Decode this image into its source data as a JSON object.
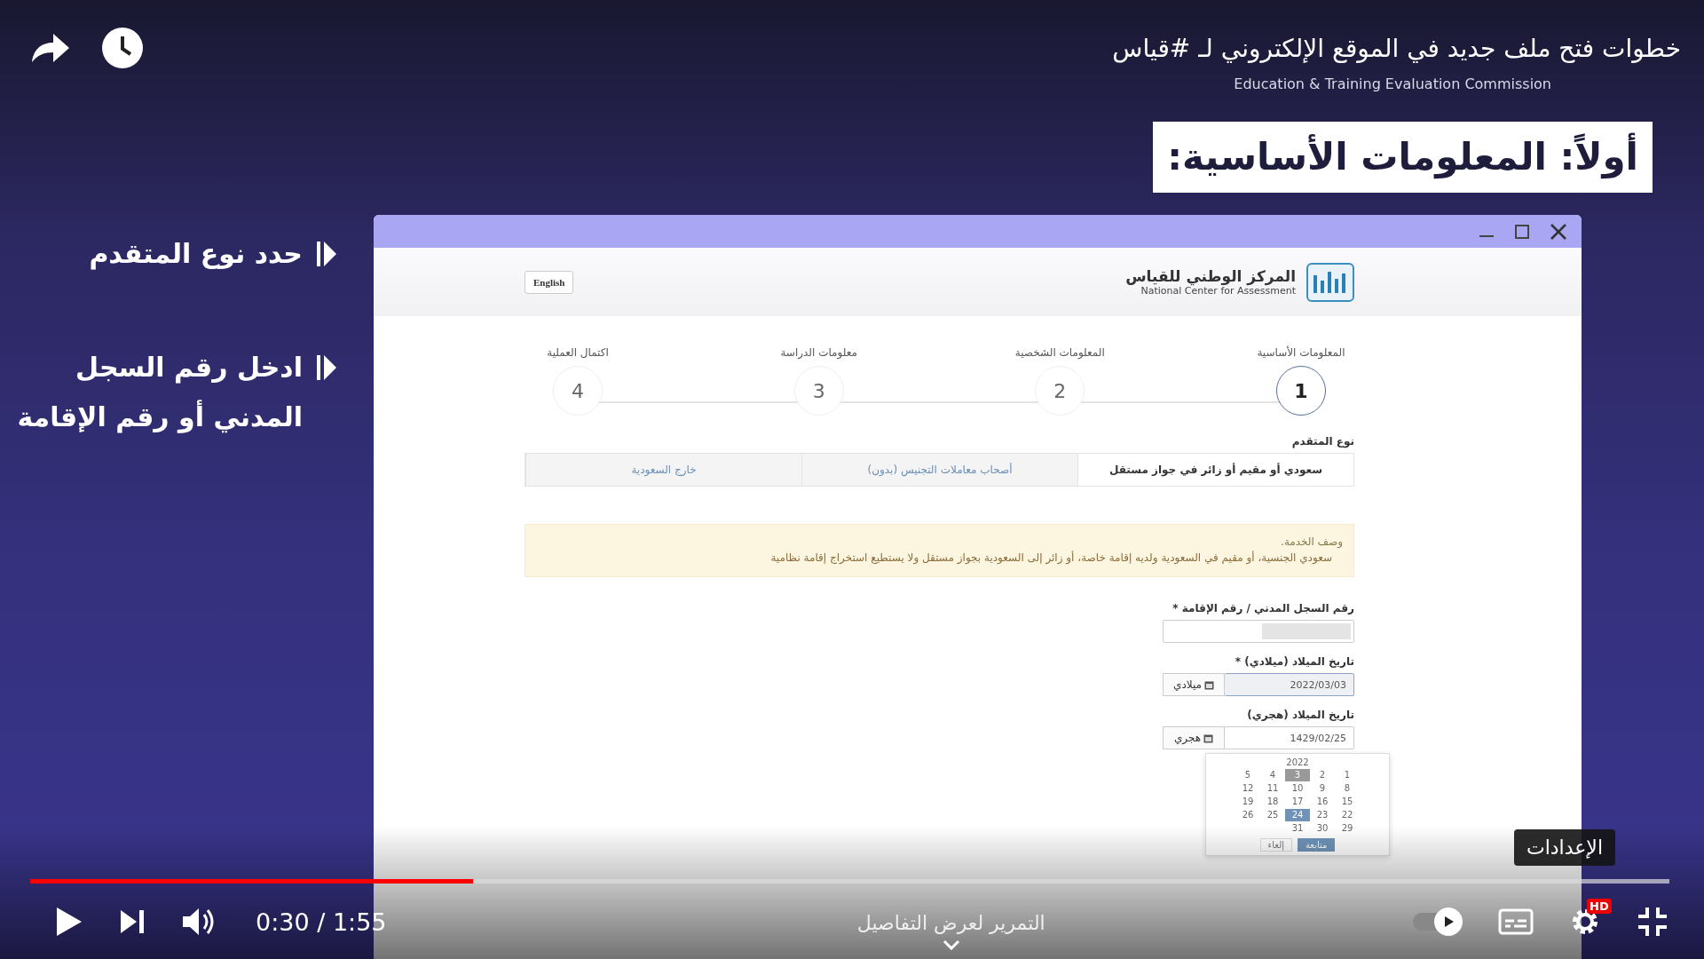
{
  "player": {
    "title": "خطوات فتح ملف جديد في الموقع الإلكتروني لـ #قياس",
    "progress": {
      "level": 0.27
    },
    "time": "0:30 / 1:55",
    "chapter": "التمرير لعرض التفاصيل",
    "autoplay": {
      "on": true
    },
    "quality_badge": "HD",
    "tooltip": "الإعدادات"
  },
  "video": {
    "branding": "Education & Training Evaluation Commission",
    "slide_heading": "أولاً: المعلومات الأساسية:",
    "instructions": [
      "حدد نوع المتقدم",
      "ادخل رقم السجل المدني أو رقم الإقامة"
    ],
    "app_window": {
      "header": {
        "org_name_ar": "المركز الوطني للقياس",
        "org_name_en": "National Center for Assessment",
        "language_button": "English"
      },
      "steps": [
        {
          "number": "1",
          "label": "المعلومات الأساسية",
          "selected": true
        },
        {
          "number": "2",
          "label": "المعلومات الشخصية",
          "selected": false
        },
        {
          "number": "3",
          "label": "معلومات الدراسة",
          "selected": false
        },
        {
          "number": "4",
          "label": "اكتمال العملية",
          "selected": false
        }
      ],
      "applicant_type": {
        "label": "نوع المتقدم",
        "tabs": [
          {
            "label": "سعودي أو مقيم أو زائر في جواز مستقل",
            "selected": true
          },
          {
            "label": "أصحاب معاملات التجنيس (بدون)",
            "selected": false
          },
          {
            "label": "خارج السعودية",
            "selected": false
          }
        ]
      },
      "notice": {
        "title": "وصف الخدمة.",
        "text": "سعودي الجنسية، أو مقيم في السعودية ولديه إقامة خاصة، أو زائر إلى السعودية بجواز مستقل ولا يستطيع استخراج إقامة نظامية"
      },
      "id_field": {
        "label": "رقم السجل المدني / رقم الإقامة *",
        "redacted": true
      },
      "birth_gregorian": {
        "label": "تاريخ الميلاد (ميلادي) *",
        "value": "2022/03/03",
        "button": "ميلادي"
      },
      "birth_hijri": {
        "label": "تاريخ الميلاد (هجري)",
        "value": "1429/02/25",
        "button": "هجري"
      },
      "datepicker": {
        "year": "2022",
        "weeks": [
          [
            {
              "day": "1",
              "selected": false,
              "today": false
            },
            {
              "day": "2",
              "selected": false,
              "today": false
            },
            {
              "day": "3",
              "selected": false,
              "today": true
            },
            {
              "day": "4",
              "selected": false,
              "today": false
            },
            {
              "day": "5",
              "selected": false,
              "today": false
            }
          ],
          [
            {
              "day": "8",
              "selected": false,
              "today": false
            },
            {
              "day": "9",
              "selected": false,
              "today": false
            },
            {
              "day": "10",
              "selected": false,
              "today": false
            },
            {
              "day": "11",
              "selected": false,
              "today": false
            },
            {
              "day": "12",
              "selected": false,
              "today": false
            }
          ],
          [
            {
              "day": "15",
              "selected": false,
              "today": false
            },
            {
              "day": "16",
              "selected": false,
              "today": false
            },
            {
              "day": "17",
              "selected": false,
              "today": false
            },
            {
              "day": "18",
              "selected": false,
              "today": false
            },
            {
              "day": "19",
              "selected": false,
              "today": false
            }
          ],
          [
            {
              "day": "22",
              "selected": false,
              "today": false
            },
            {
              "day": "23",
              "selected": false,
              "today": false
            },
            {
              "day": "24",
              "selected": true,
              "today": false
            },
            {
              "day": "25",
              "selected": false,
              "today": false
            },
            {
              "day": "26",
              "selected": false,
              "today": false
            }
          ],
          [
            {
              "day": "29",
              "selected": false,
              "today": false
            },
            {
              "day": "30",
              "selected": false,
              "today": false
            },
            {
              "day": "31",
              "selected": false,
              "today": false
            }
          ]
        ],
        "buttons": [
          {
            "label": "متابعة",
            "kind": "primary"
          },
          {
            "label": "إلغاء",
            "kind": "secondary"
          }
        ]
      }
    }
  }
}
